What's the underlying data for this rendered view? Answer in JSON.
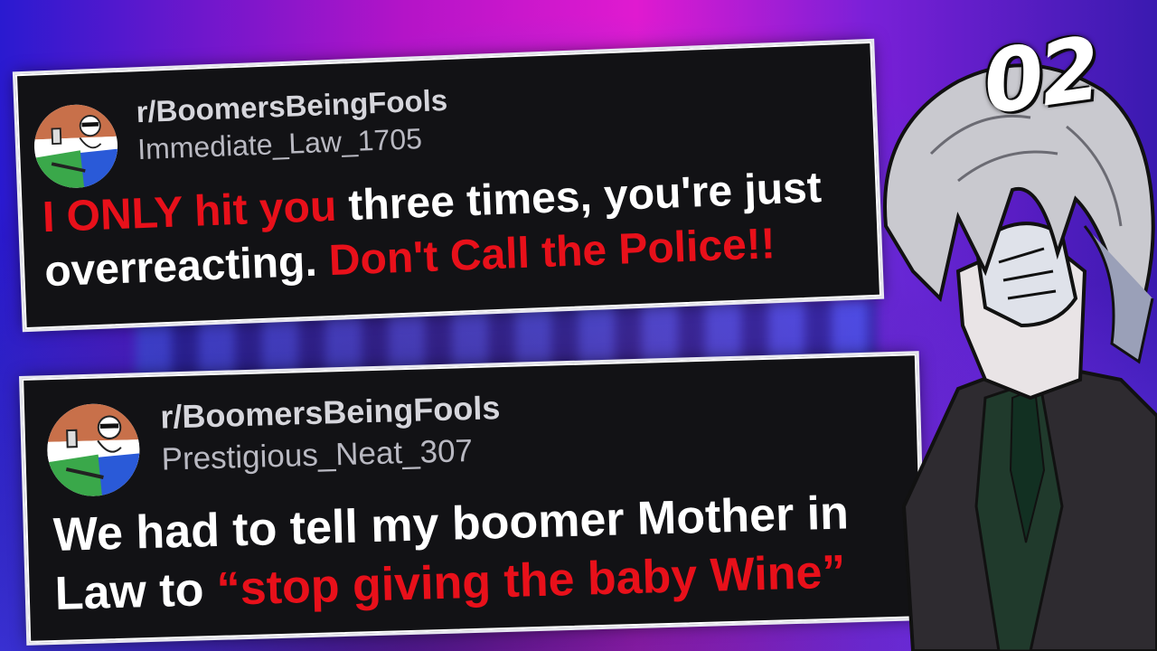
{
  "episode": "02",
  "posts": [
    {
      "subreddit": "r/BoomersBeingFools",
      "username": "Immediate_Law_1705",
      "segments": [
        {
          "text": "I ONLY hit you ",
          "color": "red"
        },
        {
          "text": "three times, you're just overreacting. ",
          "color": "white"
        },
        {
          "text": "Don't Call the Police!!",
          "color": "red"
        }
      ]
    },
    {
      "subreddit": "r/BoomersBeingFools",
      "username": "Prestigious_Neat_307",
      "segments": [
        {
          "text": "We had to tell my boomer Mother in Law to ",
          "color": "white"
        },
        {
          "text": "“stop giving the baby Wine”",
          "color": "red"
        }
      ]
    }
  ],
  "colors": {
    "accent_red": "#e8101a",
    "card_bg": "#121215",
    "text_white": "#ffffff",
    "meta_gray": "#b9b9c2"
  },
  "icons": {
    "avatar": "subreddit-avatar-icon"
  }
}
